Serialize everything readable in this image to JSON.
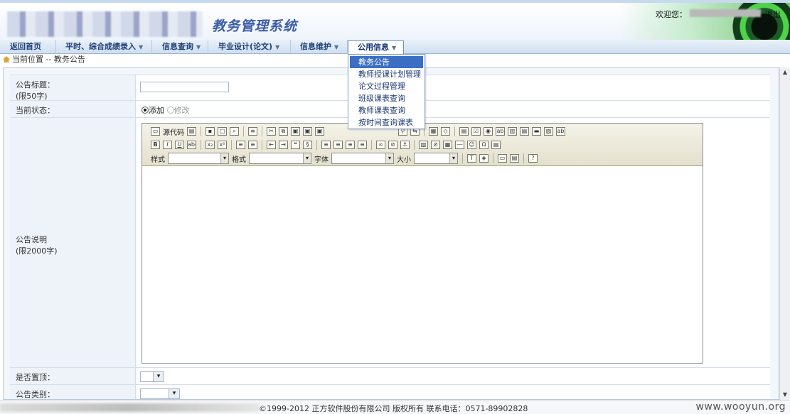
{
  "header": {
    "system_title": "教务管理系统",
    "welcome": "欢迎您：",
    "logout": "退出"
  },
  "nav": [
    {
      "label": "返回首页"
    },
    {
      "label": "平时、综合成绩录入",
      "caret": "▼"
    },
    {
      "label": "信息查询",
      "caret": "▼"
    },
    {
      "label": "毕业设计(论文)",
      "caret": "▼"
    },
    {
      "label": "信息维护",
      "caret": "▼"
    },
    {
      "label": "公用信息",
      "caret": "▼"
    }
  ],
  "dropdown": [
    "教务公告",
    "教师授课计划管理",
    "论文过程管理",
    "班级课表查询",
    "教师课表查询",
    "按时间查询课表"
  ],
  "breadcrumb": "当前位置 -- 教务公告",
  "form": {
    "title_label": "公告标题：",
    "title_limit": "(限50字)",
    "status_label": "当前状态：",
    "status_add": "添加",
    "status_edit": "修改",
    "desc_label": "公告说明",
    "desc_limit": "(限2000字)",
    "top_label": "是否置顶：",
    "category_label": "公告类别："
  },
  "editor": {
    "source": "源代码",
    "style_label": "样式",
    "format_label": "格式",
    "font_label": "字体",
    "size_label": "大小"
  },
  "footer": {
    "copyright": "©1999-2012  正方软件股份有限公司  版权所有  联系电话：0571-89902828",
    "watermark": "www.wooyun.org"
  }
}
